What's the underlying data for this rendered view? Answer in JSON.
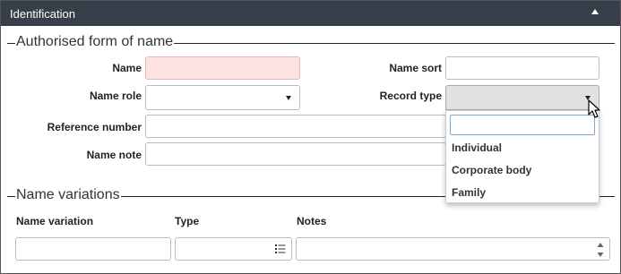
{
  "panel": {
    "title": "Identification"
  },
  "authorised": {
    "legend": "Authorised form of name",
    "name_label": "Name",
    "name_sort_label": "Name sort",
    "name_role_label": "Name role",
    "record_type_label": "Record type",
    "reference_number_label": "Reference number",
    "name_note_label": "Name note"
  },
  "record_type_dropdown": {
    "search_value": "",
    "options": [
      "Individual",
      "Corporate body",
      "Family"
    ]
  },
  "variations": {
    "legend": "Name variations",
    "columns": [
      "Name variation",
      "Type",
      "Notes"
    ]
  },
  "colors": {
    "header_bg": "#37404a",
    "required_bg": "#fde2e2"
  }
}
